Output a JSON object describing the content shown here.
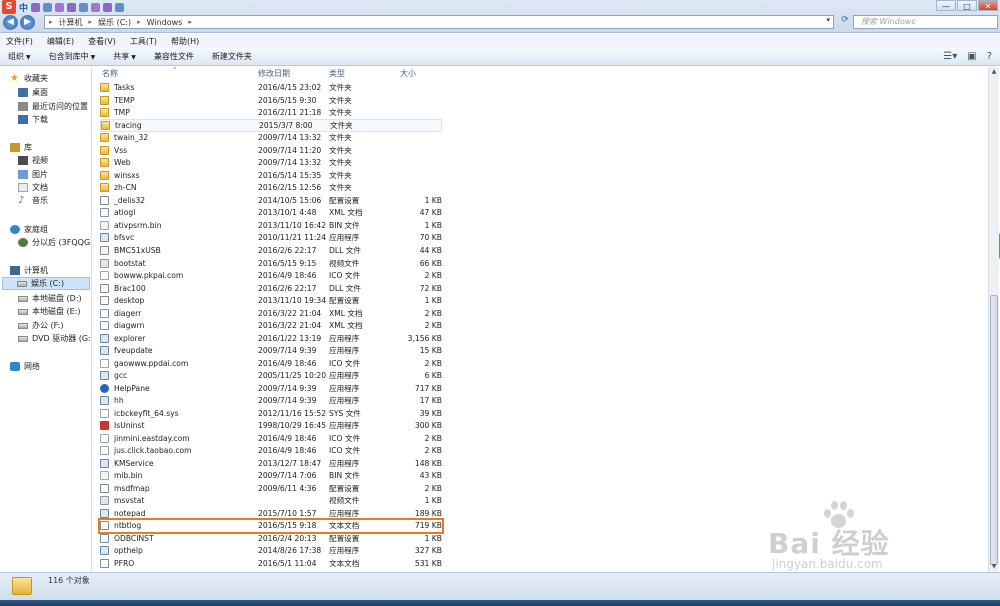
{
  "ime": {
    "logo": "S",
    "mode": "中"
  },
  "address": {
    "crumbs": [
      "计算机",
      "娱乐 (C:)",
      "Windows"
    ]
  },
  "search": {
    "placeholder": "搜索 Windows"
  },
  "window_controls": {
    "min": "—",
    "max": "□",
    "close": "✕"
  },
  "menu": [
    "文件(F)",
    "编辑(E)",
    "查看(V)",
    "工具(T)",
    "帮助(H)"
  ],
  "toolbar": {
    "organize": "组织",
    "include_in_library": "包含到库中",
    "share": "共享",
    "compat_files": "兼容性文件",
    "new_folder": "新建文件夹"
  },
  "sidebar": {
    "favorites": "收藏夹",
    "desktop": "桌面",
    "recent": "最近访问的位置",
    "downloads": "下载",
    "libraries": "库",
    "videos": "视频",
    "pictures": "图片",
    "documents": "文档",
    "music": "音乐",
    "homegroup": "家庭组",
    "homegroup_user": "分以后 (3FQQGPU",
    "computer": "计算机",
    "drive_c": "娱乐 (C:)",
    "drive_d": "本地磁盘 (D:)",
    "drive_e": "本地磁盘 (E:)",
    "drive_f": "办公 (F:)",
    "drive_g": "DVD 驱动器 (G:) 5",
    "network": "网络"
  },
  "columns": {
    "name": "名称",
    "date": "修改日期",
    "type": "类型",
    "size": "大小"
  },
  "files": [
    {
      "name": "Tasks",
      "date": "2016/4/15 23:02",
      "type": "文件夹",
      "size": "",
      "icon": "folder"
    },
    {
      "name": "TEMP",
      "date": "2016/5/15 9:30",
      "type": "文件夹",
      "size": "",
      "icon": "folder"
    },
    {
      "name": "TMP",
      "date": "2016/2/11 21:18",
      "type": "文件夹",
      "size": "",
      "icon": "folder"
    },
    {
      "name": "tracing",
      "date": "2015/3/7 8:00",
      "type": "文件夹",
      "size": "",
      "icon": "folder"
    },
    {
      "name": "twain_32",
      "date": "2009/7/14 13:32",
      "type": "文件夹",
      "size": "",
      "icon": "folder"
    },
    {
      "name": "Vss",
      "date": "2009/7/14 11:20",
      "type": "文件夹",
      "size": "",
      "icon": "folder"
    },
    {
      "name": "Web",
      "date": "2009/7/14 13:32",
      "type": "文件夹",
      "size": "",
      "icon": "folder"
    },
    {
      "name": "winsxs",
      "date": "2016/5/14 15:35",
      "type": "文件夹",
      "size": "",
      "icon": "folder"
    },
    {
      "name": "zh-CN",
      "date": "2016/2/15 12:56",
      "type": "文件夹",
      "size": "",
      "icon": "folder"
    },
    {
      "name": "_delis32",
      "date": "2014/10/5 15:06",
      "type": "配置设置",
      "size": "1 KB",
      "icon": "ini"
    },
    {
      "name": "atiogl",
      "date": "2013/10/1 4:48",
      "type": "XML 文档",
      "size": "47 KB",
      "icon": "xml"
    },
    {
      "name": "ativpsrm.bin",
      "date": "2013/11/10 16:42",
      "type": "BIN 文件",
      "size": "1 KB",
      "icon": "bin"
    },
    {
      "name": "bfsvc",
      "date": "2010/11/21 11:24",
      "type": "应用程序",
      "size": "70 KB",
      "icon": "exe"
    },
    {
      "name": "BMC51xUSB",
      "date": "2016/2/6 22:17",
      "type": "DLL 文件",
      "size": "44 KB",
      "icon": "dll"
    },
    {
      "name": "bootstat",
      "date": "2016/5/15 9:15",
      "type": "视频文件",
      "size": "66 KB",
      "icon": "bmp"
    },
    {
      "name": "bowww.pkpai.com",
      "date": "2016/4/9 18:46",
      "type": "ICO 文件",
      "size": "2 KB",
      "icon": "ico"
    },
    {
      "name": "Brac100",
      "date": "2016/2/6 22:17",
      "type": "DLL 文件",
      "size": "72 KB",
      "icon": "dll"
    },
    {
      "name": "desktop",
      "date": "2013/11/10 19:34",
      "type": "配置设置",
      "size": "1 KB",
      "icon": "ini"
    },
    {
      "name": "diagerr",
      "date": "2016/3/22 21:04",
      "type": "XML 文档",
      "size": "2 KB",
      "icon": "xml"
    },
    {
      "name": "diagwrn",
      "date": "2016/3/22 21:04",
      "type": "XML 文档",
      "size": "2 KB",
      "icon": "xml"
    },
    {
      "name": "explorer",
      "date": "2016/1/22 13:19",
      "type": "应用程序",
      "size": "3,156 KB",
      "icon": "exe"
    },
    {
      "name": "fveupdate",
      "date": "2009/7/14 9:39",
      "type": "应用程序",
      "size": "15 KB",
      "icon": "exe"
    },
    {
      "name": "gaowww.ppdai.com",
      "date": "2016/4/9 18:46",
      "type": "ICO 文件",
      "size": "2 KB",
      "icon": "ico"
    },
    {
      "name": "gcc",
      "date": "2005/11/25 10:20",
      "type": "应用程序",
      "size": "6 KB",
      "icon": "exe"
    },
    {
      "name": "HelpPane",
      "date": "2009/7/14 9:39",
      "type": "应用程序",
      "size": "717 KB",
      "icon": "help"
    },
    {
      "name": "hh",
      "date": "2009/7/14 9:39",
      "type": "应用程序",
      "size": "17 KB",
      "icon": "exe"
    },
    {
      "name": "icbckeyflt_64.sys",
      "date": "2012/11/16 15:52",
      "type": "SYS 文件",
      "size": "39 KB",
      "icon": "sys"
    },
    {
      "name": "IsUninst",
      "date": "1998/10/29 16:45",
      "type": "应用程序",
      "size": "300 KB",
      "icon": "uninst"
    },
    {
      "name": "jinmini.eastday.com",
      "date": "2016/4/9 18:46",
      "type": "ICO 文件",
      "size": "2 KB",
      "icon": "ico"
    },
    {
      "name": "jus.click.taobao.com",
      "date": "2016/4/9 18:46",
      "type": "ICO 文件",
      "size": "2 KB",
      "icon": "ico"
    },
    {
      "name": "KMService",
      "date": "2013/12/7 18:47",
      "type": "应用程序",
      "size": "148 KB",
      "icon": "exe"
    },
    {
      "name": "mib.bin",
      "date": "2009/7/14 7:06",
      "type": "BIN 文件",
      "size": "43 KB",
      "icon": "bin"
    },
    {
      "name": "msdfmap",
      "date": "2009/6/11 4:36",
      "type": "配置设置",
      "size": "2 KB",
      "icon": "ini"
    },
    {
      "name": "msvstat",
      "date": "",
      "type": "视频文件",
      "size": "1 KB",
      "icon": "bmp"
    },
    {
      "name": "notepad",
      "date": "2015/7/10 1:57",
      "type": "应用程序",
      "size": "189 KB",
      "icon": "exe"
    },
    {
      "name": "ntbtlog",
      "date": "2016/5/15 9:18",
      "type": "文本文档",
      "size": "719 KB",
      "icon": "txt"
    },
    {
      "name": "ODBCINST",
      "date": "2016/2/4 20:13",
      "type": "配置设置",
      "size": "1 KB",
      "icon": "ini"
    },
    {
      "name": "opthelp",
      "date": "2014/8/26 17:38",
      "type": "应用程序",
      "size": "327 KB",
      "icon": "exe"
    },
    {
      "name": "PFRO",
      "date": "2016/5/1 11:04",
      "type": "文本文档",
      "size": "531 KB",
      "icon": "txt"
    }
  ],
  "hover_row": "tracing",
  "highlight_row": "ntbtlog",
  "status": {
    "count": "116 个对象"
  },
  "watermark": {
    "brand": "Bai  经验",
    "url": "jingyan.baidu.com"
  },
  "accent": "#ec7a1c"
}
